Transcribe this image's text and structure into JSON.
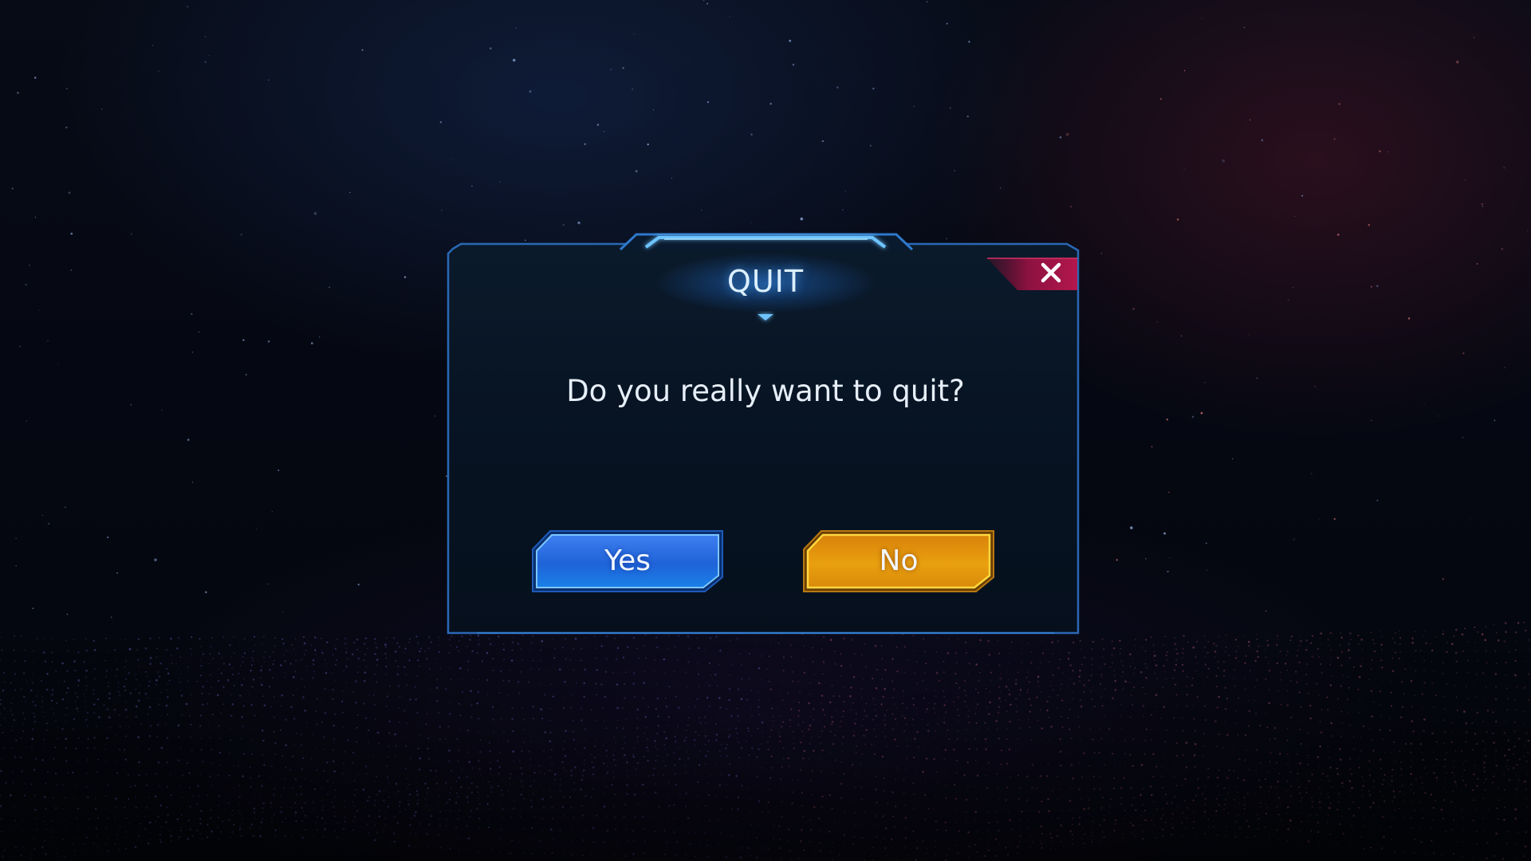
{
  "dialog": {
    "title": "QUIT",
    "message": "Do you really want to quit?",
    "close_icon": "close-icon",
    "buttons": {
      "confirm_label": "Yes",
      "cancel_label": "No"
    }
  },
  "colors": {
    "frame_border": "#2c6fc0",
    "frame_fill": "#081626",
    "title_glow": "#50aaff",
    "close_accent": "#b0174a",
    "confirm_button": "#1f6fe0",
    "cancel_button": "#e89a0c",
    "cancel_border": "#ffd23a"
  }
}
